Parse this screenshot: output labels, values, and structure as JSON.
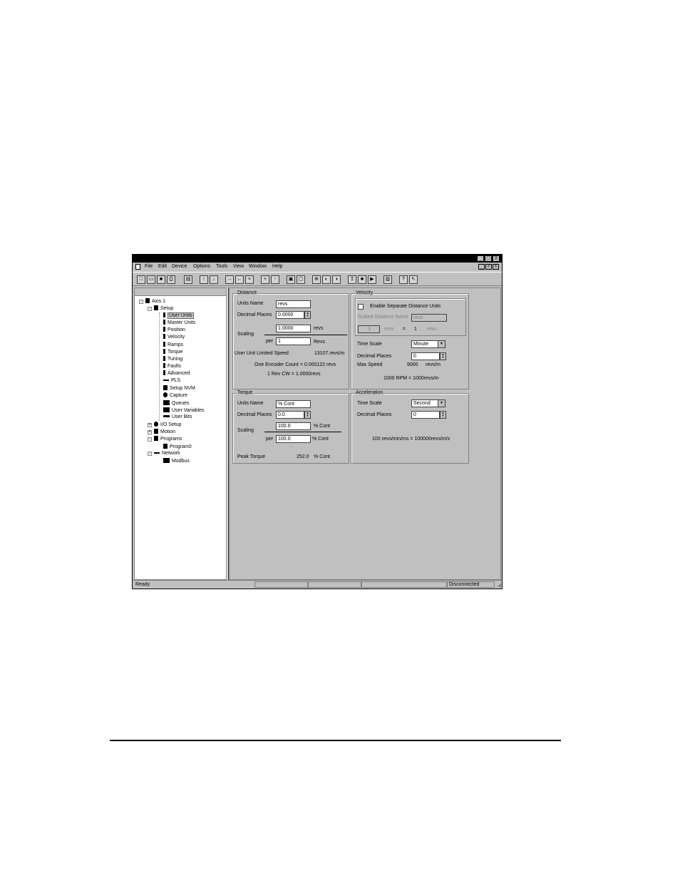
{
  "menu": {
    "items": [
      "File",
      "Edit",
      "Device",
      "Options",
      "Tools",
      "View",
      "Window",
      "Help"
    ]
  },
  "titlebar": {
    "min": "_",
    "max": "□",
    "close": "X"
  },
  "mdi": {
    "min": "_",
    "restore": "#",
    "close": "X"
  },
  "tree": {
    "root": "Axis 1",
    "setup": "Setup",
    "setup_items": [
      "User Units",
      "Master Units",
      "Position",
      "Velocity",
      "Ramps",
      "Torque",
      "Tuning",
      "Faults",
      "Advanced",
      "PLS",
      "Setup NVM",
      "Capture",
      "Queues",
      "User Variables",
      "User Bits"
    ],
    "io_setup": "I/O Setup",
    "motion": "Motion",
    "programs": "Programs",
    "program0": "Program0",
    "network": "Network",
    "modbus": "Modbus"
  },
  "distance": {
    "legend": "Distance",
    "units_name_label": "Units Name",
    "units_name_value": "revs",
    "decimal_places_label": "Decimal Places",
    "decimal_places_value": "0.0000",
    "scaling_label": "Scaling",
    "scaling_value": "1.0000",
    "scaling_units": "revs",
    "per_label": "per",
    "per_value": "1",
    "per_units": "Revs",
    "limited_speed_label": "User Unit Limited Speed",
    "limited_speed_value": "13107.revs/m",
    "encoder_count": "One Encoder Count = 0.000122 revs",
    "rev_cw": "1 Rev CW = 1.0000revs"
  },
  "velocity": {
    "legend": "Velocity",
    "enable_label": "Enable Separate Distance Units",
    "scaled_name_label": "Scaled Distance Name",
    "scaled_name_value": "revs",
    "conv_left_value": "1",
    "conv_left_units": "revs",
    "conv_eq": "=",
    "conv_right_value": "1",
    "conv_right_units": "revs",
    "time_scale_label": "Time Scale",
    "time_scale_value": "Minute",
    "decimal_places_label": "Decimal Places",
    "decimal_places_value": "0",
    "max_speed_label": "Max Speed",
    "max_speed_value": "5000",
    "max_speed_units": "revs/m",
    "rpm_note": "1000 RPM = 1000revs/m"
  },
  "torque": {
    "legend": "Torque",
    "units_name_label": "Units Name",
    "units_name_value": "% Cont",
    "decimal_places_label": "Decimal Places",
    "decimal_places_value": "0.0",
    "scaling_label": "Scaling",
    "scaling_value": "100.0",
    "scaling_units": "% Cont",
    "per_label": "per",
    "per_value": "100.0",
    "per_units": "% Cont",
    "peak_label": "Peak Torque",
    "peak_value": "252.0",
    "peak_units": "% Cont"
  },
  "acceleration": {
    "legend": "Acceleration",
    "time_scale_label": "Time Scale",
    "time_scale_value": "Second",
    "decimal_places_label": "Decimal Places",
    "decimal_places_value": "0",
    "note": "100 revs/min/ms = 100000revs/m/s"
  },
  "status": {
    "ready": "Ready",
    "connection": "Disconnected"
  }
}
